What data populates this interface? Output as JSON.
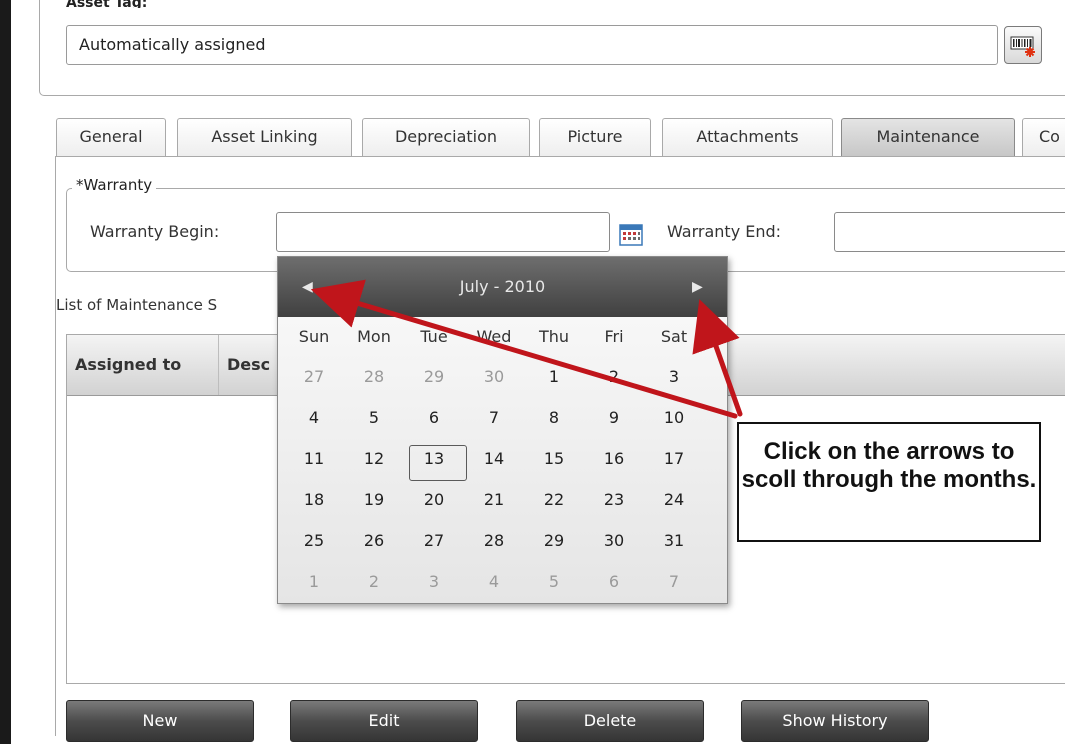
{
  "asset_tag": {
    "legend": "Asset Tag:",
    "value": "Automatically assigned",
    "icon": "barcode-generate-icon"
  },
  "tabs": [
    {
      "label": "General",
      "active": false
    },
    {
      "label": "Asset Linking",
      "active": false
    },
    {
      "label": "Depreciation",
      "active": false
    },
    {
      "label": "Picture",
      "active": false
    },
    {
      "label": "Attachments",
      "active": false
    },
    {
      "label": "Maintenance",
      "active": true
    },
    {
      "label": "Co",
      "active": false
    }
  ],
  "warranty": {
    "legend": "*Warranty",
    "begin_label": "Warranty Begin:",
    "begin_value": "",
    "end_label": "Warranty End:",
    "end_value": "",
    "calendar_icon": "calendar-icon"
  },
  "maintenance_list": {
    "label": "List of Maintenance S",
    "columns": [
      "Assigned to",
      "Desc"
    ]
  },
  "buttons": {
    "new": "New",
    "edit": "Edit",
    "delete": "Delete",
    "history": "Show History"
  },
  "calendar": {
    "title": "July - 2010",
    "prev_icon": "chevron-left-icon",
    "next_icon": "chevron-right-icon",
    "weekdays": [
      "Sun",
      "Mon",
      "Tue",
      "Wed",
      "Thu",
      "Fri",
      "Sat"
    ],
    "weeks": [
      [
        "27",
        "28",
        "29",
        "30",
        "1",
        "2",
        "3"
      ],
      [
        "4",
        "5",
        "6",
        "7",
        "8",
        "9",
        "10"
      ],
      [
        "11",
        "12",
        "13",
        "14",
        "15",
        "16",
        "17"
      ],
      [
        "18",
        "19",
        "20",
        "21",
        "22",
        "23",
        "24"
      ],
      [
        "25",
        "26",
        "27",
        "28",
        "29",
        "30",
        "31"
      ],
      [
        "1",
        "2",
        "3",
        "4",
        "5",
        "6",
        "7"
      ]
    ],
    "selected_day": "13"
  },
  "annotation": {
    "text": "Click on the arrows to scoll through the months.",
    "arrow_color": "#c0151b"
  }
}
